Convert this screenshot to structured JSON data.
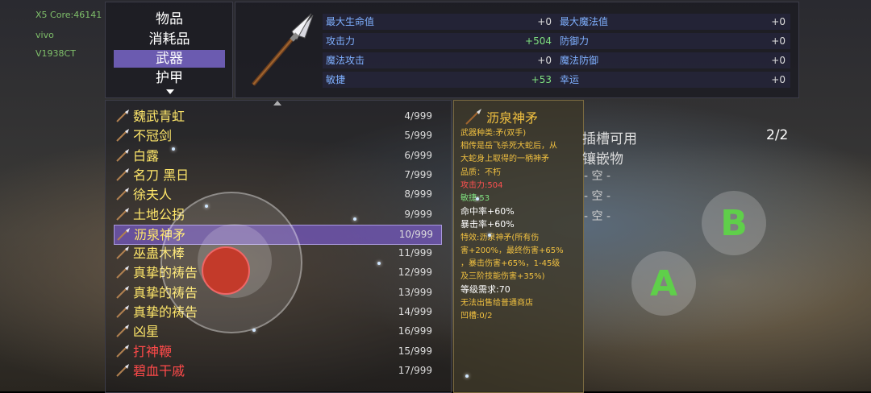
{
  "system": {
    "line1": "X5 Core:46141",
    "line2": "vivo",
    "line3": "V1938CT"
  },
  "categories": {
    "items": [
      {
        "label": "物品"
      },
      {
        "label": "消耗品"
      },
      {
        "label": "武器",
        "selected": true
      },
      {
        "label": "护甲"
      }
    ]
  },
  "stats": {
    "left": [
      {
        "label": "最大生命值",
        "value": "+0",
        "green": false
      },
      {
        "label": "攻击力",
        "value": "+504",
        "green": true
      },
      {
        "label": "魔法攻击",
        "value": "+0",
        "green": false
      },
      {
        "label": "敏捷",
        "value": "+53",
        "green": true
      }
    ],
    "right": [
      {
        "label": "最大魔法值",
        "value": "+0"
      },
      {
        "label": "防御力",
        "value": "+0"
      },
      {
        "label": "魔法防御",
        "value": "+0"
      },
      {
        "label": "幸运",
        "value": "+0"
      }
    ]
  },
  "items": [
    {
      "name": "魏武青虹",
      "count": "4/999",
      "color": "#ffe76a"
    },
    {
      "name": "不冠剑",
      "count": "5/999",
      "color": "#ffe76a"
    },
    {
      "name": "白露",
      "count": "6/999",
      "color": "#ffe76a"
    },
    {
      "name": "名刀 黑日",
      "count": "7/999",
      "color": "#ffe76a"
    },
    {
      "name": "徐夫人",
      "count": "8/999",
      "color": "#ffe76a"
    },
    {
      "name": "土地公拐",
      "count": "9/999",
      "color": "#ffe76a"
    },
    {
      "name": "沥泉神矛",
      "count": "10/999",
      "color": "#ffe76a",
      "selected": true
    },
    {
      "name": "巫蛊木棒",
      "count": "11/999",
      "color": "#ffe76a"
    },
    {
      "name": "真挚的祷告",
      "count": "12/999",
      "color": "#ffe76a"
    },
    {
      "name": "真挚的祷告",
      "count": "13/999",
      "color": "#ffe76a"
    },
    {
      "name": "真挚的祷告",
      "count": "14/999",
      "color": "#ffe76a"
    },
    {
      "name": "凶星",
      "count": "16/999",
      "color": "#ffe76a"
    },
    {
      "name": "打神鞭",
      "count": "15/999",
      "color": "#ff4a4a"
    },
    {
      "name": "碧血干戚",
      "count": "17/999",
      "color": "#ff4a4a"
    }
  ],
  "detail": {
    "title": "沥泉神矛",
    "lines": [
      {
        "text": "武器种类:矛(双手)",
        "color": "#f0c040"
      },
      {
        "text": "相传是岳飞杀死大蛇后，从",
        "color": "#f0c040"
      },
      {
        "text": "大蛇身上取得的一柄神矛",
        "color": "#f0c040"
      },
      {
        "text": "品质：不朽",
        "color": "#f0c040"
      },
      {
        "text": "攻击力:504",
        "color": "#ff5050"
      },
      {
        "text": "敏捷:53",
        "color": "#7fe07f"
      },
      {
        "text": "命中率+60%",
        "color": "#ffffff"
      },
      {
        "text": "暴击率+60%",
        "color": "#ffffff"
      },
      {
        "text": "特效:沥泉神矛(所有伤",
        "color": "#f0c040"
      },
      {
        "text": "害+200%，最终伤害+65%",
        "color": "#f0c040"
      },
      {
        "text": "，暴击伤害+65%，1-45级",
        "color": "#f0c040"
      },
      {
        "text": "及三阶技能伤害+35%)",
        "color": "#f0c040"
      },
      {
        "text": "等级需求:70",
        "color": "#ffffff"
      },
      {
        "text": "无法出售给普通商店",
        "color": "#f0c040"
      },
      {
        "text": "凹槽:0/2",
        "color": "#f0c040"
      }
    ]
  },
  "slots": {
    "title_line1": "插槽可用",
    "title_line2": "镶嵌物",
    "count": "2/2",
    "empty": [
      "- 空 -",
      "- 空 -",
      "- 空 -"
    ]
  },
  "buttons": {
    "b_label": "B",
    "a_label": "A"
  },
  "colors": {
    "accent": "#6b5bb0",
    "stat_label": "#7fb0ff",
    "green": "#7fe07f",
    "yellow": "#ffe76a",
    "red": "#ff4a4a"
  }
}
